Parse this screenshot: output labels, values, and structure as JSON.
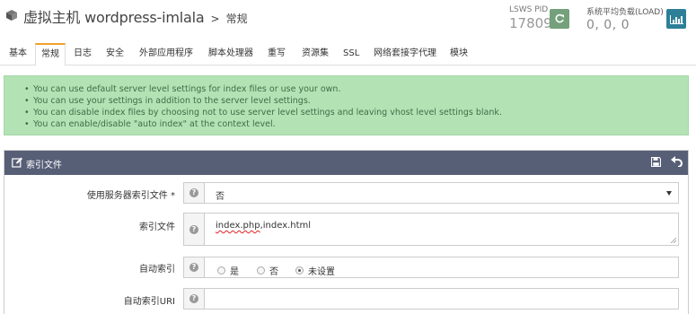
{
  "header": {
    "title": "虚拟主机 wordpress-imlala",
    "separator": ">",
    "subtitle": "常规",
    "pid_label": "LSWS PID",
    "pid_value": "17809",
    "load_label": "系统平均负载(LOAD)",
    "load_value": "0, 0, 0"
  },
  "tabs": [
    {
      "label": "基本",
      "active": false
    },
    {
      "label": "常规",
      "active": true
    },
    {
      "label": "日志",
      "active": false
    },
    {
      "label": "安全",
      "active": false
    },
    {
      "label": "外部应用程序",
      "active": false
    },
    {
      "label": "脚本处理器",
      "active": false
    },
    {
      "label": "重写",
      "active": false
    },
    {
      "label": "资源集",
      "active": false
    },
    {
      "label": "SSL",
      "active": false
    },
    {
      "label": "网络套接字代理",
      "active": false
    },
    {
      "label": "模块",
      "active": false
    }
  ],
  "alert": {
    "items": [
      "You can use default server level settings for index files or use your own.",
      "You can use your settings in addition to the server level settings.",
      "You can disable index files by choosing not to use server level settings and leaving vhost level settings blank.",
      "You can enable/disable \"auto index\" at the context level."
    ]
  },
  "panel": {
    "title": "索引文件",
    "fields": {
      "use_server_index": {
        "label": "使用服务器索引文件 *",
        "value": "否"
      },
      "index_files": {
        "label": "索引文件",
        "value_spell": "index.php",
        "value_rest": ",index.html"
      },
      "auto_index": {
        "label": "自动索引",
        "options": [
          "是",
          "否",
          "未设置"
        ],
        "selected": "未设置"
      },
      "auto_index_uri": {
        "label": "自动索引URI",
        "value": ""
      }
    }
  },
  "colors": {
    "panel_header": "#575f77",
    "alert_bg": "#b3e3b5",
    "alert_text": "#3d6e45",
    "restart_button": "#74a07c",
    "chart_button": "#2d7f98",
    "active_tab_accent": "#f0a030"
  },
  "icons": {
    "header": "cube-icon",
    "restart": "refresh-icon",
    "load": "bar-chart-icon",
    "panel_title": "edit-icon",
    "panel_save": "floppy-disk-icon",
    "panel_undo": "undo-icon",
    "help": "question-circle-icon"
  }
}
